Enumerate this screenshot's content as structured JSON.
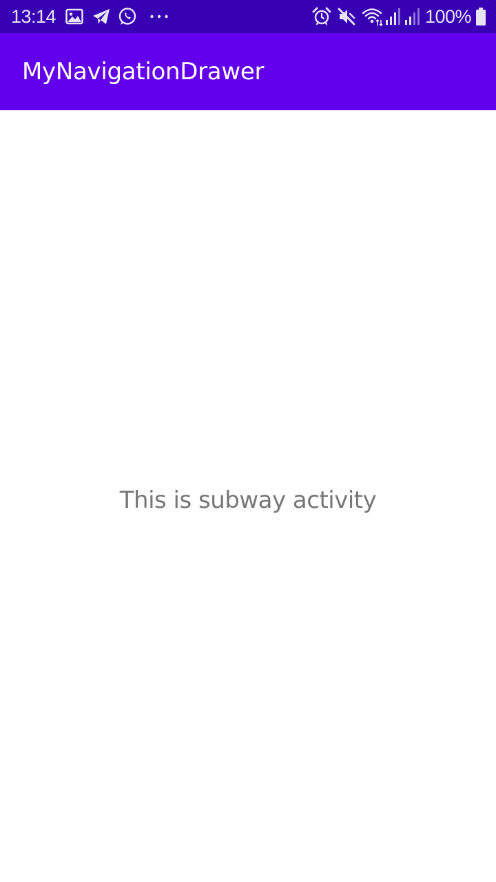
{
  "status_bar": {
    "time": "13:14",
    "left_icons": [
      "image-icon",
      "telegram-icon",
      "whatsapp-icon",
      "more-dots-icon"
    ],
    "right_icons": [
      "alarm-icon",
      "mute-icon",
      "wifi-icon",
      "signal-icon",
      "signal-icon-2",
      "battery-icon"
    ],
    "battery_percent": "100%",
    "background_color": "#3700b3"
  },
  "app_bar": {
    "title": "MyNavigationDrawer",
    "background_color": "#6200ee"
  },
  "main": {
    "message": "This is subway activity"
  }
}
